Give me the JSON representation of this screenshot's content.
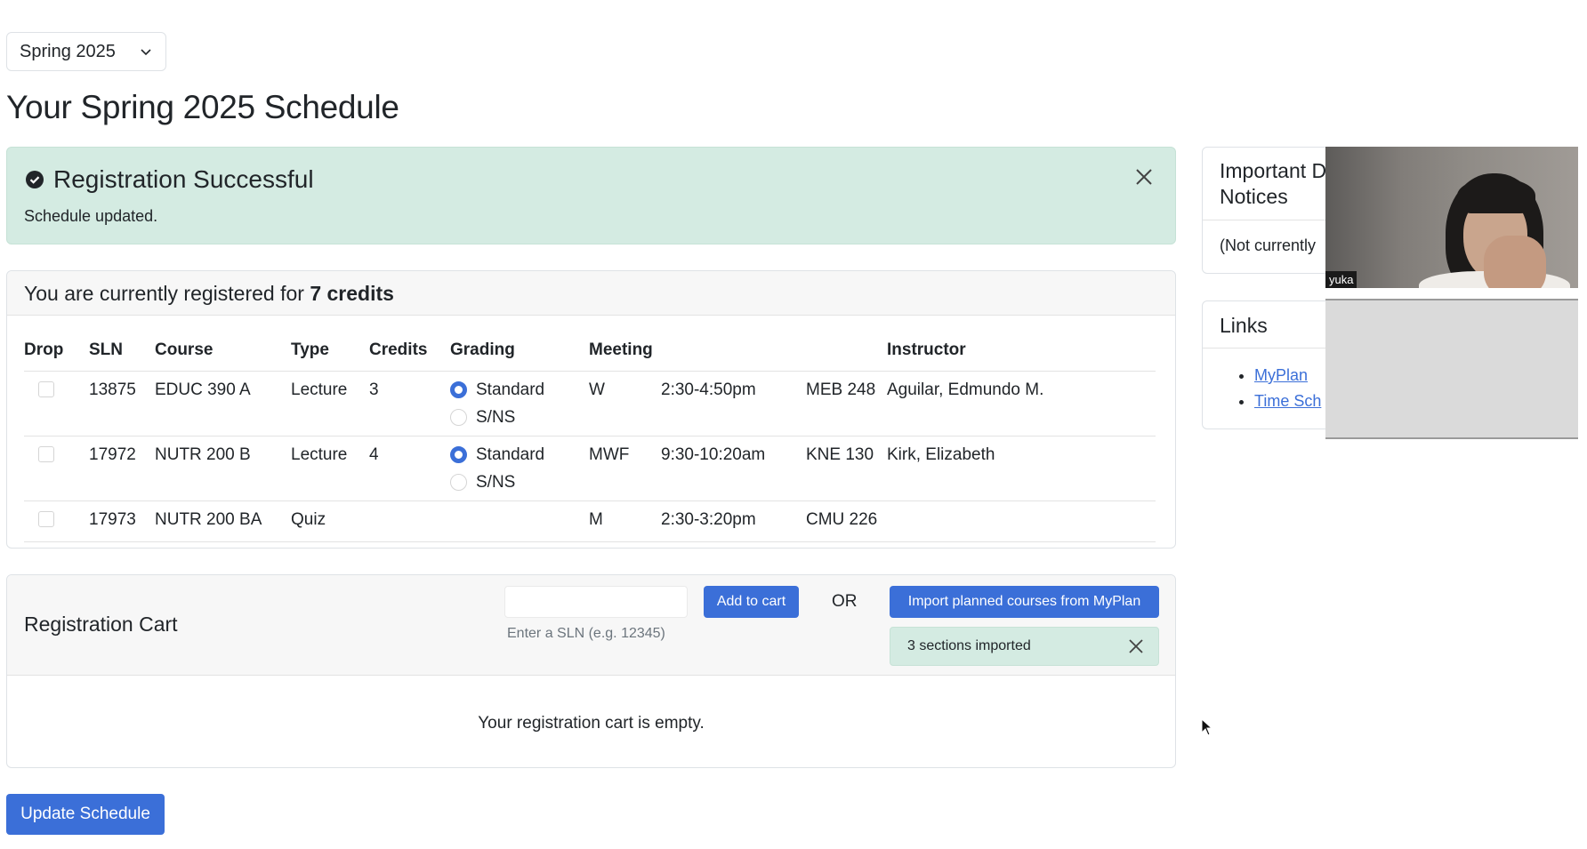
{
  "term_selector": {
    "value": "Spring 2025"
  },
  "page_title": "Your Spring 2025 Schedule",
  "alert": {
    "title": "Registration Successful",
    "message": "Schedule updated.",
    "color": "#d4ebe2"
  },
  "schedule": {
    "header_prefix": "You are currently registered for",
    "credits_text": "7 credits",
    "columns": [
      "Drop",
      "SLN",
      "Course",
      "Type",
      "Credits",
      "Grading",
      "Meeting",
      "",
      "",
      "Instructor"
    ],
    "rows": [
      {
        "sln": "13875",
        "course": "EDUC 390 A",
        "type": "Lecture",
        "credits": "3",
        "grading": [
          "Standard",
          "S/NS"
        ],
        "grading_selected": "Standard",
        "days": "W",
        "time": "2:30-4:50pm",
        "room": "MEB 248",
        "instructor": "Aguilar, Edmundo M."
      },
      {
        "sln": "17972",
        "course": "NUTR 200 B",
        "type": "Lecture",
        "credits": "4",
        "grading": [
          "Standard",
          "S/NS"
        ],
        "grading_selected": "Standard",
        "days": "MWF",
        "time": "9:30-10:20am",
        "room": "KNE 130",
        "instructor": "Kirk, Elizabeth"
      },
      {
        "sln": "17973",
        "course": "NUTR 200 BA",
        "type": "Quiz",
        "credits": "",
        "grading": [],
        "grading_selected": "",
        "days": "M",
        "time": "2:30-3:20pm",
        "room": "CMU 226",
        "instructor": ""
      }
    ]
  },
  "notices": {
    "title_line1": "Important D",
    "title_line2": "Notices",
    "body": "(Not currently"
  },
  "links": {
    "title": "Links",
    "items": [
      "MyPlan",
      "Time Sch"
    ]
  },
  "video": {
    "participant_name": "yuka"
  },
  "cart": {
    "title": "Registration Cart",
    "sln_value": "",
    "sln_help": "Enter a SLN (e.g. 12345)",
    "add_label": "Add to cart",
    "or_label": "OR",
    "import_label": "Import planned courses from MyPlan",
    "import_status": "3 sections imported",
    "empty_message": "Your registration cart is empty."
  },
  "update_button": "Update Schedule",
  "colors": {
    "accent": "#3b6fd8",
    "success_bg": "#d4ebe2"
  }
}
